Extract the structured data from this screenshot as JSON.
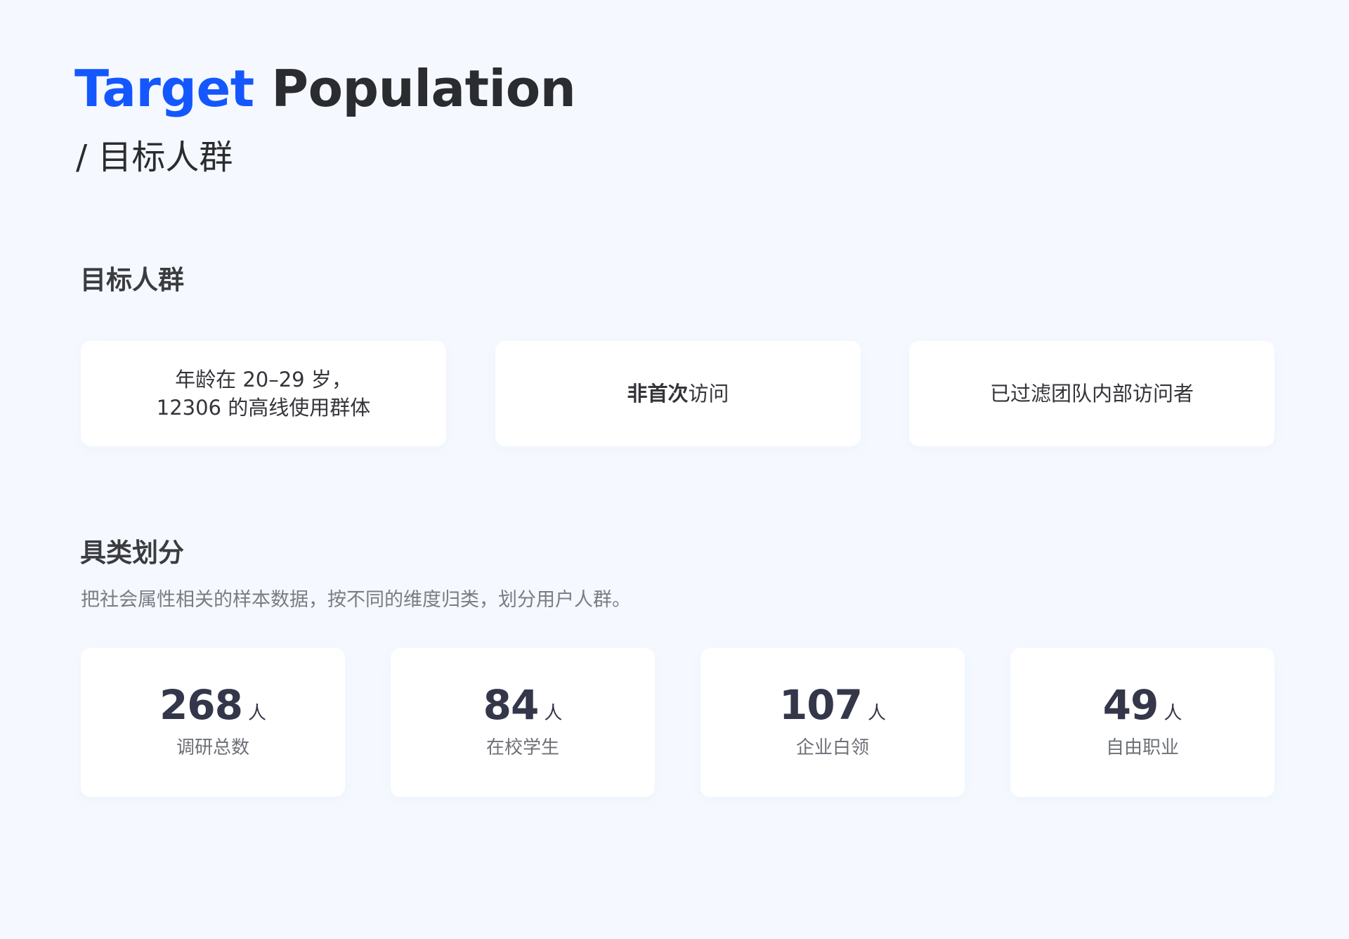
{
  "header": {
    "title_accent": "Target",
    "title_rest": "Population",
    "subtitle": "/ 目标人群"
  },
  "target_section": {
    "title": "目标人群",
    "cards": [
      {
        "line1": "年龄在 20–29 岁，",
        "line2": "12306 的高线使用群体"
      },
      {
        "bold": "非首次",
        "normal": "访问"
      },
      {
        "text": "已过滤团队内部访问者"
      }
    ]
  },
  "segment_section": {
    "title": "具类划分",
    "description": "把社会属性相关的样本数据，按不同的维度归类，划分用户人群。",
    "stats": [
      {
        "value": "268",
        "unit": "人",
        "label": "调研总数"
      },
      {
        "value": "84",
        "unit": "人",
        "label": "在校学生"
      },
      {
        "value": "107",
        "unit": "人",
        "label": "企业白领"
      },
      {
        "value": "49",
        "unit": "人",
        "label": "自由职业"
      }
    ]
  }
}
